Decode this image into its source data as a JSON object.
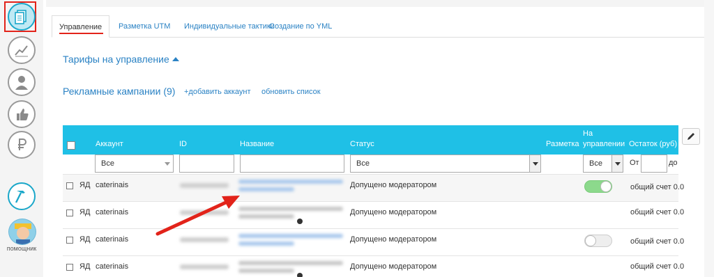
{
  "sidebar": {
    "items": [
      {
        "icon": "documents-icon",
        "active": true
      },
      {
        "icon": "chart-line-icon",
        "active": false
      },
      {
        "icon": "user-icon",
        "active": false
      },
      {
        "icon": "thumbs-up-icon",
        "active": false
      },
      {
        "icon": "ruble-icon",
        "active": false
      },
      {
        "icon": "hammer-icon",
        "active": false
      }
    ],
    "helper_label": "помощник"
  },
  "tabs": [
    {
      "label": "Управление",
      "active": true
    },
    {
      "label": "Разметка UTM",
      "active": false
    },
    {
      "label": "Индивидуальные тактики",
      "active": false
    },
    {
      "label": "Создание по YML",
      "active": false
    }
  ],
  "tariffs": {
    "title": "Тарифы на управление"
  },
  "campaigns": {
    "title": "Рекламные кампании (9)",
    "add_account": "+добавить аккаунт",
    "refresh_list": "обновить список"
  },
  "table": {
    "headers": {
      "account": "Аккаунт",
      "id": "ID",
      "name": "Название",
      "status": "Статус",
      "markup": "Разметка",
      "managed_line1": "На",
      "managed_line2": "управлении",
      "remainder": "Остаток (руб)"
    },
    "filters": {
      "account": "Все",
      "status": "Все",
      "managed": "Все",
      "from_label": "От",
      "to_label": "до"
    },
    "rows": [
      {
        "source": "ЯД",
        "account": "caterinais",
        "status": "Допущено модератором",
        "managed": "on",
        "remainder": "общий счет 0.0"
      },
      {
        "source": "ЯД",
        "account": "caterinais",
        "status": "Допущено модератором",
        "managed": "none",
        "remainder": "общий счет 0.0"
      },
      {
        "source": "ЯД",
        "account": "caterinais",
        "status": "Допущено модератором",
        "managed": "off",
        "remainder": "общий счет 0.0"
      },
      {
        "source": "ЯД",
        "account": "caterinais",
        "status": "Допущено модератором",
        "managed": "none",
        "remainder": "общий счет 0.0"
      }
    ]
  },
  "colors": {
    "accent": "#1fc0e6",
    "link": "#2a82c4",
    "highlight": "#e2231a",
    "toggle_on": "#8cd98c"
  }
}
